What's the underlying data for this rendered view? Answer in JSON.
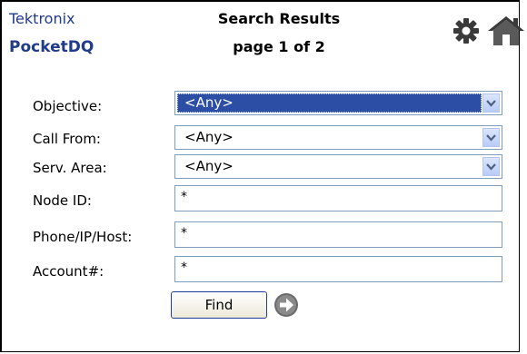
{
  "header": {
    "brand": "Tektronix",
    "app_name": "PocketDQ",
    "title": "Search Results",
    "subtitle": "page 1 of 2",
    "icons": [
      "gear-icon",
      "home-icon"
    ]
  },
  "form": {
    "objective": {
      "label": "Objective:",
      "value": "<Any>"
    },
    "call_from": {
      "label": "Call From:",
      "value": "<Any>"
    },
    "serv_area": {
      "label": "Serv. Area:",
      "value": "<Any>"
    },
    "node_id": {
      "label": "Node ID:",
      "value": "*"
    },
    "phone": {
      "label": "Phone/IP/Host:",
      "value": "*"
    },
    "account": {
      "label": "Account#:",
      "value": "*"
    },
    "find_label": "Find",
    "go_icon": "arrow-right-circle-icon"
  },
  "colors": {
    "brand": "#1f3b8a",
    "selection": "#2c4fa5",
    "field_border": "#7f9db9"
  }
}
